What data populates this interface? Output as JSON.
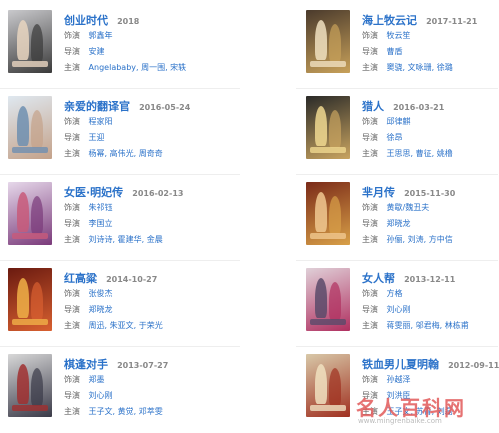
{
  "labels": {
    "writer": "饰演",
    "director": "导演",
    "cast": "主演"
  },
  "movies": [
    {
      "title": "创业时代",
      "year": "2018",
      "role": "郭鑫年",
      "director": "安建",
      "cast": "Angelababy, 周一围, 宋轶",
      "colors": [
        "#c9c9cc",
        "#3a3a3a",
        "#e8d5c0"
      ]
    },
    {
      "title": "海上牧云记",
      "year": "2017-11-21",
      "role": "牧云笙",
      "director": "曹盾",
      "cast": "窦骁, 文咏珊, 徐璐",
      "colors": [
        "#4a3a2c",
        "#c8a15a",
        "#f0e0c0"
      ]
    },
    {
      "title": "亲爱的翻译官",
      "year": "2016-05-24",
      "role": "程家阳",
      "director": "王迎",
      "cast": "杨幂, 高伟光, 周奇奇",
      "colors": [
        "#dfe8f0",
        "#c4a28a",
        "#6f8fb0"
      ]
    },
    {
      "title": "猎人",
      "year": "2016-03-21",
      "role": "邱律麒",
      "director": "徐昂",
      "cast": "王思思, 曹征, 姚橹",
      "colors": [
        "#2a2a28",
        "#c9a460",
        "#f0d890"
      ]
    },
    {
      "title": "女医·明妃传",
      "year": "2016-02-13",
      "role": "朱祁钰",
      "director": "李国立",
      "cast": "刘诗诗, 霍建华, 金晨",
      "colors": [
        "#e6d8ea",
        "#7a3a7a",
        "#c85a7a"
      ]
    },
    {
      "title": "芈月传",
      "year": "2015-11-30",
      "role": "黄歇/魏丑夫",
      "director": "郑晓龙",
      "cast": "孙俪, 刘涛, 方中信",
      "colors": [
        "#7a2a18",
        "#d8a048",
        "#f0c890"
      ]
    },
    {
      "title": "红高粱",
      "year": "2014-10-27",
      "role": "张俊杰",
      "director": "郑晓龙",
      "cast": "周迅, 朱亚文, 于荣光",
      "colors": [
        "#6a1a10",
        "#d86030",
        "#f0b048"
      ]
    },
    {
      "title": "女人帮",
      "year": "2013-12-11",
      "role": "方格",
      "director": "刘心刚",
      "cast": "蒋雯丽, 邬君梅, 林栋甫",
      "colors": [
        "#e0d0d8",
        "#b03060",
        "#5a4a6a"
      ]
    },
    {
      "title": "棋逢对手",
      "year": "2013-07-27",
      "role": "郑墨",
      "director": "刘心刚",
      "cast": "王子文, 黄觉, 邓萃雯",
      "colors": [
        "#d8d8d8",
        "#3a3a48",
        "#a03030"
      ]
    },
    {
      "title": "铁血男儿夏明翰",
      "year": "2012-09-11",
      "role": "孙越泽",
      "director": "刘洪臣",
      "cast": "王子文, 苏青, 刘磊",
      "colors": [
        "#d8c8a8",
        "#a03020",
        "#f0e0c0"
      ]
    }
  ],
  "watermark": {
    "text": "名人百科网",
    "sub": "www.mingrenbaike.com"
  }
}
